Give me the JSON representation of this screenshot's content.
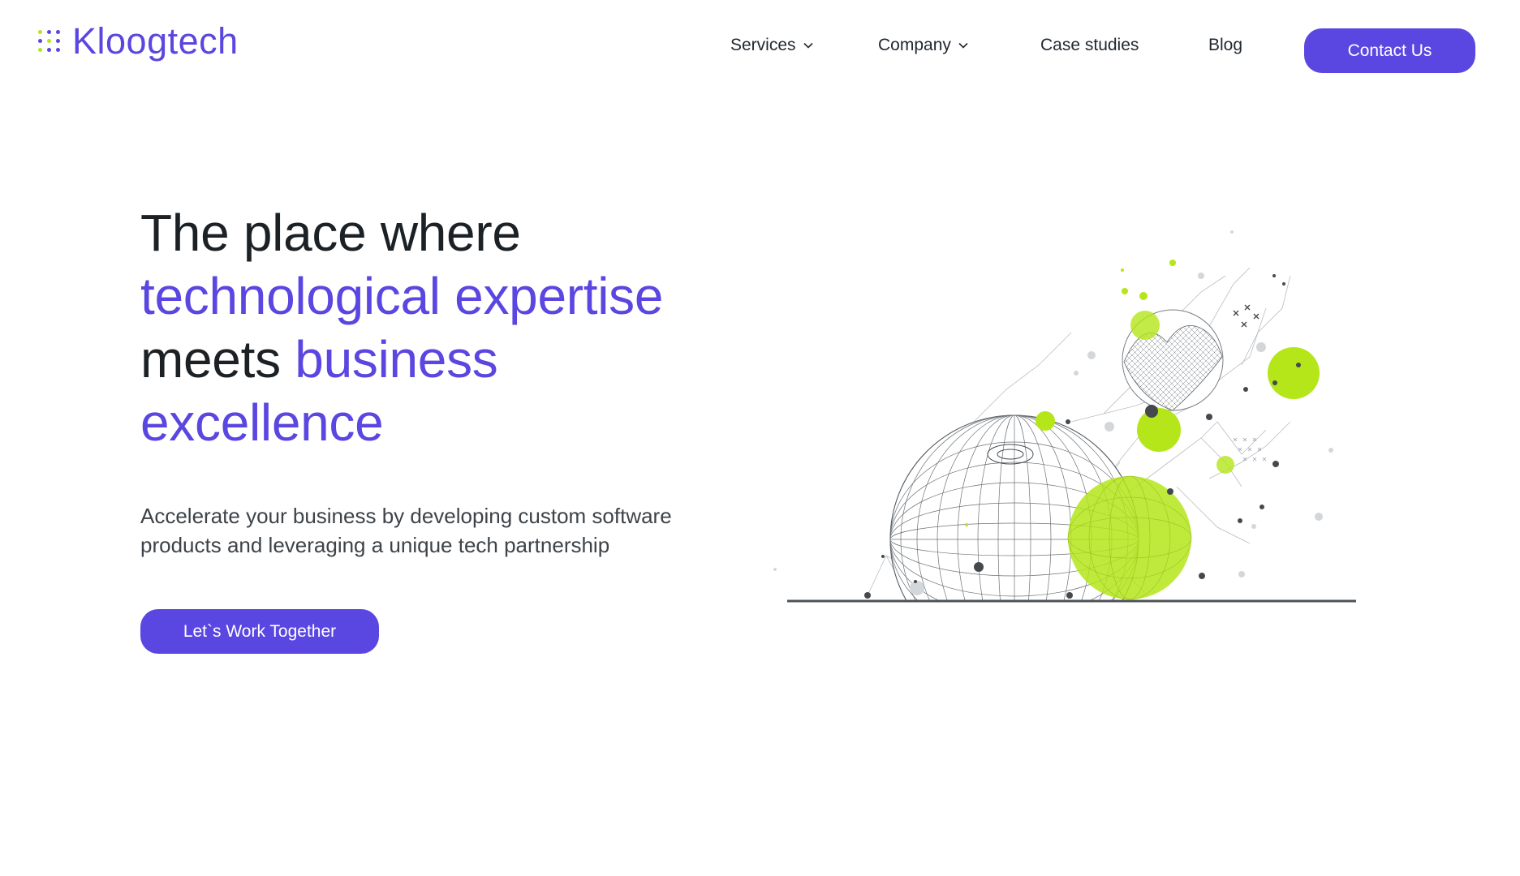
{
  "brand": {
    "name": "Kloogtech",
    "primary_color": "#5a46e0",
    "accent_color": "#b4e61a"
  },
  "nav": {
    "items": [
      {
        "label": "Services",
        "has_dropdown": true
      },
      {
        "label": "Company",
        "has_dropdown": true
      },
      {
        "label": "Case studies",
        "has_dropdown": false
      },
      {
        "label": "Blog",
        "has_dropdown": false
      }
    ],
    "contact_label": "Contact Us"
  },
  "hero": {
    "title_line1": "The place where",
    "title_accent1": "technological expertise",
    "title_plain2": "meets",
    "title_accent2": "business",
    "title_accent3": "excellence",
    "subtitle": "Accelerate your business by developing custom software products and leveraging a unique tech partnership",
    "cta_label": "Let`s Work Together"
  },
  "illustration": {
    "icon": "network-globe-illustration"
  }
}
